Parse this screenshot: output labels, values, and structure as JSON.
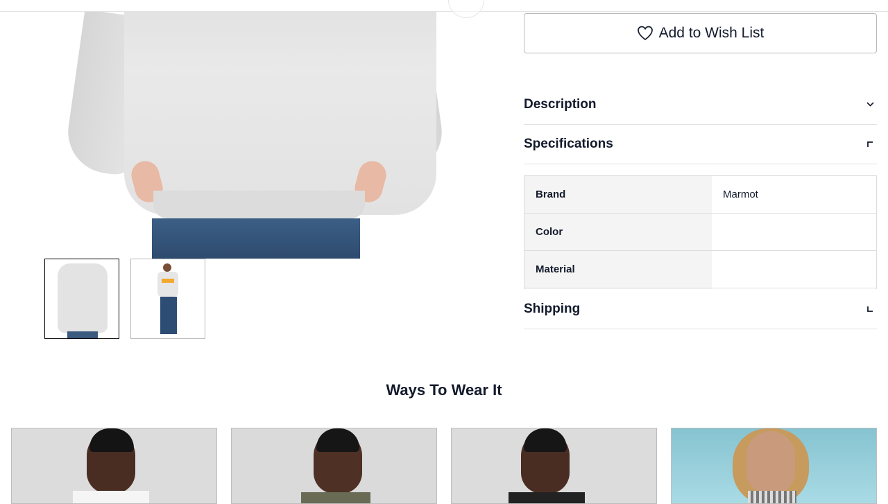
{
  "product": {
    "images": [
      {
        "name": "back-view",
        "alt": "Hoodie back view"
      },
      {
        "name": "front-view",
        "alt": "Hoodie front view"
      }
    ]
  },
  "wishlist": {
    "label": "Add to Wish List"
  },
  "accordions": {
    "description": {
      "title": "Description",
      "state": "collapsed"
    },
    "specifications": {
      "title": "Specifications",
      "state": "expanded"
    },
    "shipping": {
      "title": "Shipping",
      "state": "collapsed"
    }
  },
  "specs": [
    {
      "key": "Brand",
      "value": "Marmot"
    },
    {
      "key": "Color",
      "value": ""
    },
    {
      "key": "Material",
      "value": ""
    }
  ],
  "ways_to_wear": {
    "title": "Ways To Wear It"
  },
  "colors": {
    "text": "#121a2b",
    "border": "#dcdcdc",
    "spec_key_bg": "#f4f4f4"
  }
}
